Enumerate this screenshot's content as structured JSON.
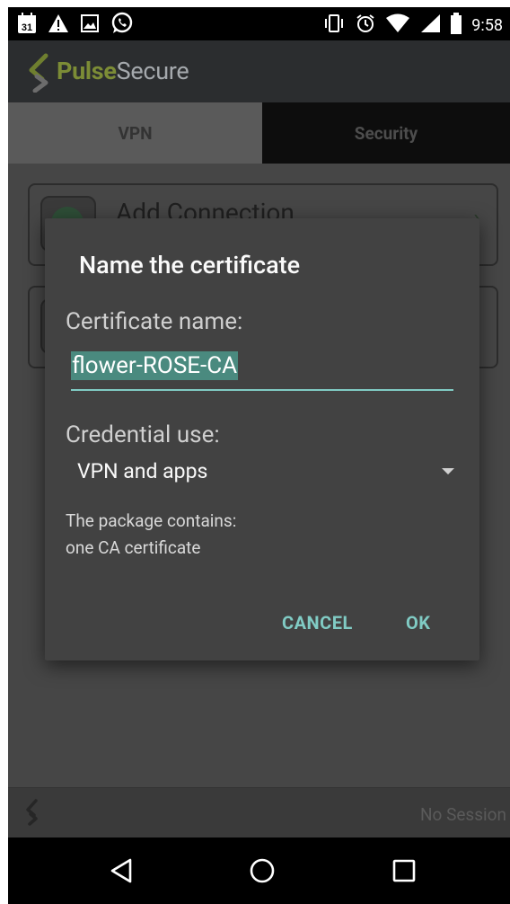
{
  "status_bar": {
    "time": "9:58",
    "left_icons": [
      "calendar-icon",
      "warning-icon",
      "image-icon",
      "whatsapp-icon"
    ],
    "right_icons": [
      "vibrate-icon",
      "alarm-icon",
      "wifi-icon",
      "signal-icon",
      "battery-icon"
    ],
    "calendar_day": "31"
  },
  "app_bar": {
    "brand_part1": "Pulse",
    "brand_part2": "Secure"
  },
  "tabs": [
    {
      "label": "VPN",
      "selected": true
    },
    {
      "label": "Security",
      "selected": false
    }
  ],
  "list": {
    "items": [
      {
        "title": "Add Connection"
      }
    ]
  },
  "dialog": {
    "title": "Name the certificate",
    "certificate_label": "Certificate name:",
    "certificate_value": "flower-ROSE-CA",
    "credential_label": "Credential use:",
    "credential_value": "VPN and apps",
    "package_line1": "The package contains:",
    "package_line2": "one CA certificate",
    "cancel_label": "CANCEL",
    "ok_label": "OK"
  },
  "session_bar": {
    "status": "No Session"
  },
  "colors": {
    "accent": "#80cbc4",
    "dialog_bg": "#424242",
    "brand_green": "#7c8c36"
  }
}
